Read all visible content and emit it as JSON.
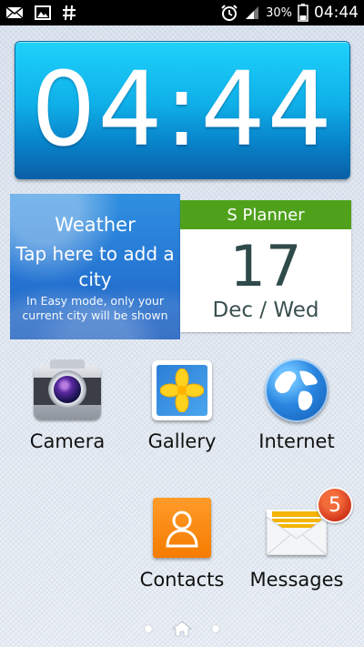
{
  "status_bar": {
    "battery_percent": "30%",
    "time": "04:44",
    "left_icons": [
      "mail-icon",
      "image-icon",
      "hash-icon"
    ],
    "right_icons": [
      "alarm-icon",
      "signal-icon",
      "battery-icon"
    ]
  },
  "clock": {
    "time": "04:44"
  },
  "weather": {
    "title": "Weather",
    "action": "Tap here to add a city",
    "note": "In Easy mode, only your current city will be shown"
  },
  "planner": {
    "title": "S Planner",
    "day": "17",
    "date": "Dec / Wed",
    "header_color": "#4fa11b"
  },
  "apps": [
    {
      "label": "Camera",
      "icon": "camera-icon"
    },
    {
      "label": "Gallery",
      "icon": "gallery-icon"
    },
    {
      "label": "Internet",
      "icon": "globe-icon"
    },
    {
      "label": "Contacts",
      "icon": "contacts-icon"
    },
    {
      "label": "Messages",
      "icon": "envelope-icon",
      "badge": "5"
    }
  ],
  "page_indicator": {
    "pages": 3,
    "current": "home"
  }
}
